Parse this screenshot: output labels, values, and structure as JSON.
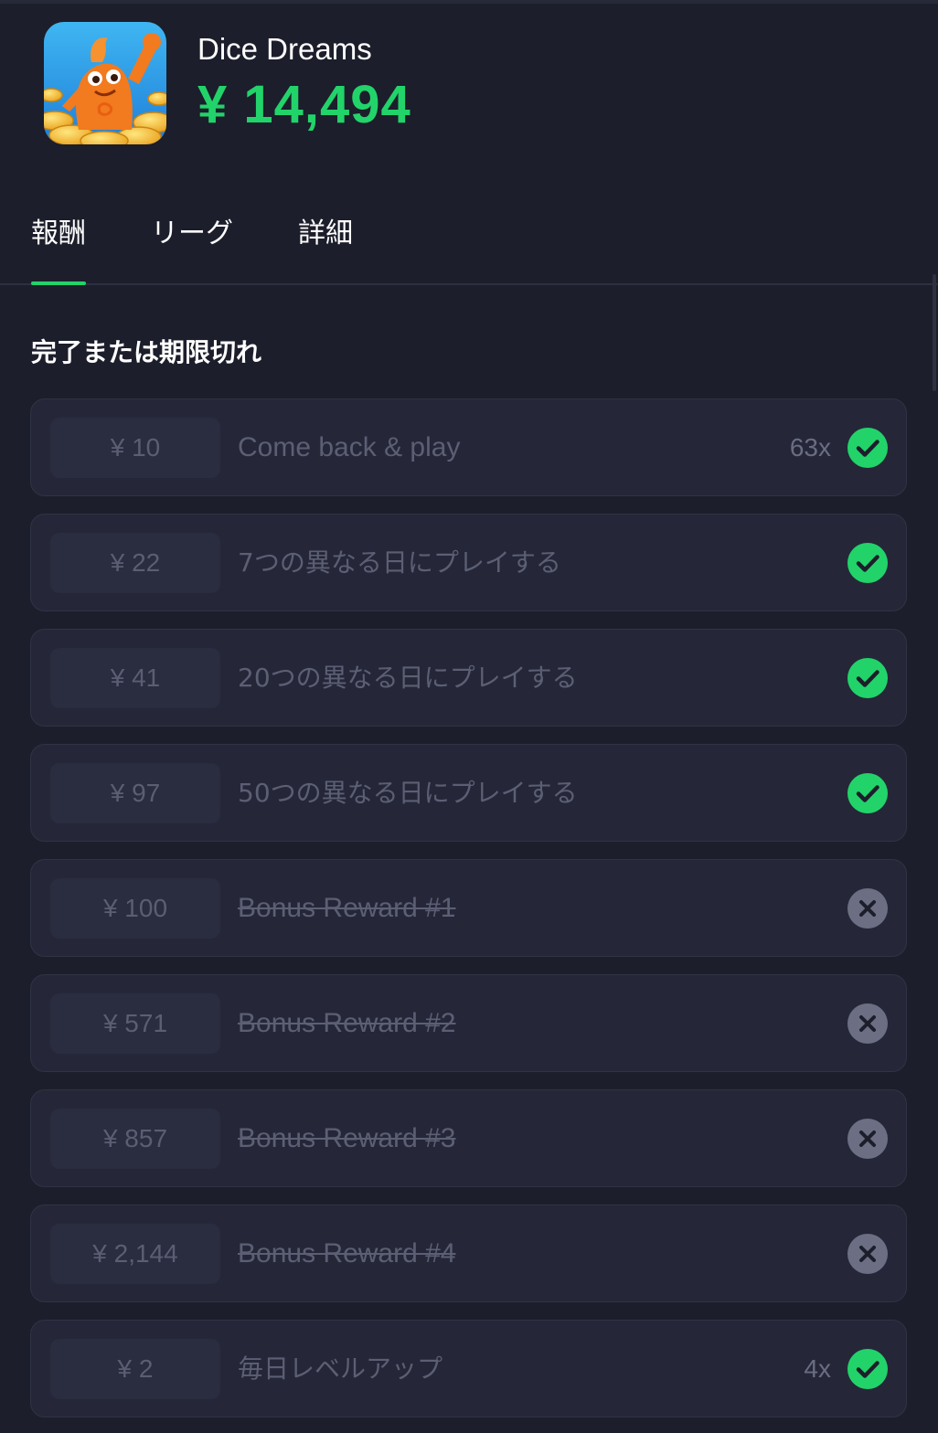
{
  "app": {
    "name": "Dice Dreams",
    "total": "¥ 14,494",
    "icon": "dice-dreams-app-icon"
  },
  "tabs": [
    {
      "label": "報酬",
      "active": true
    },
    {
      "label": "リーグ",
      "active": false
    },
    {
      "label": "詳細",
      "active": false
    }
  ],
  "section": {
    "title": "完了または期限切れ"
  },
  "rewards": [
    {
      "amount": "¥ 10",
      "title": "Come back & play",
      "count": "63x",
      "status": "completed",
      "struck": false
    },
    {
      "amount": "¥ 22",
      "title": "7つの異なる日にプレイする",
      "count": "",
      "status": "completed",
      "struck": false
    },
    {
      "amount": "¥ 41",
      "title": "20つの異なる日にプレイする",
      "count": "",
      "status": "completed",
      "struck": false
    },
    {
      "amount": "¥ 97",
      "title": "50つの異なる日にプレイする",
      "count": "",
      "status": "completed",
      "struck": false
    },
    {
      "amount": "¥ 100",
      "title": "Bonus Reward #1",
      "count": "",
      "status": "expired",
      "struck": true
    },
    {
      "amount": "¥ 571",
      "title": "Bonus Reward #2",
      "count": "",
      "status": "expired",
      "struck": true
    },
    {
      "amount": "¥ 857",
      "title": "Bonus Reward #3",
      "count": "",
      "status": "expired",
      "struck": true
    },
    {
      "amount": "¥ 2,144",
      "title": "Bonus Reward #4",
      "count": "",
      "status": "expired",
      "struck": true
    },
    {
      "amount": "¥ 2",
      "title": "毎日レベルアップ",
      "count": "4x",
      "status": "completed",
      "struck": false
    }
  ],
  "colors": {
    "accent": "#22d36a",
    "background": "#1c1e2b",
    "card": "#252738",
    "expired": "#6c6e84"
  }
}
